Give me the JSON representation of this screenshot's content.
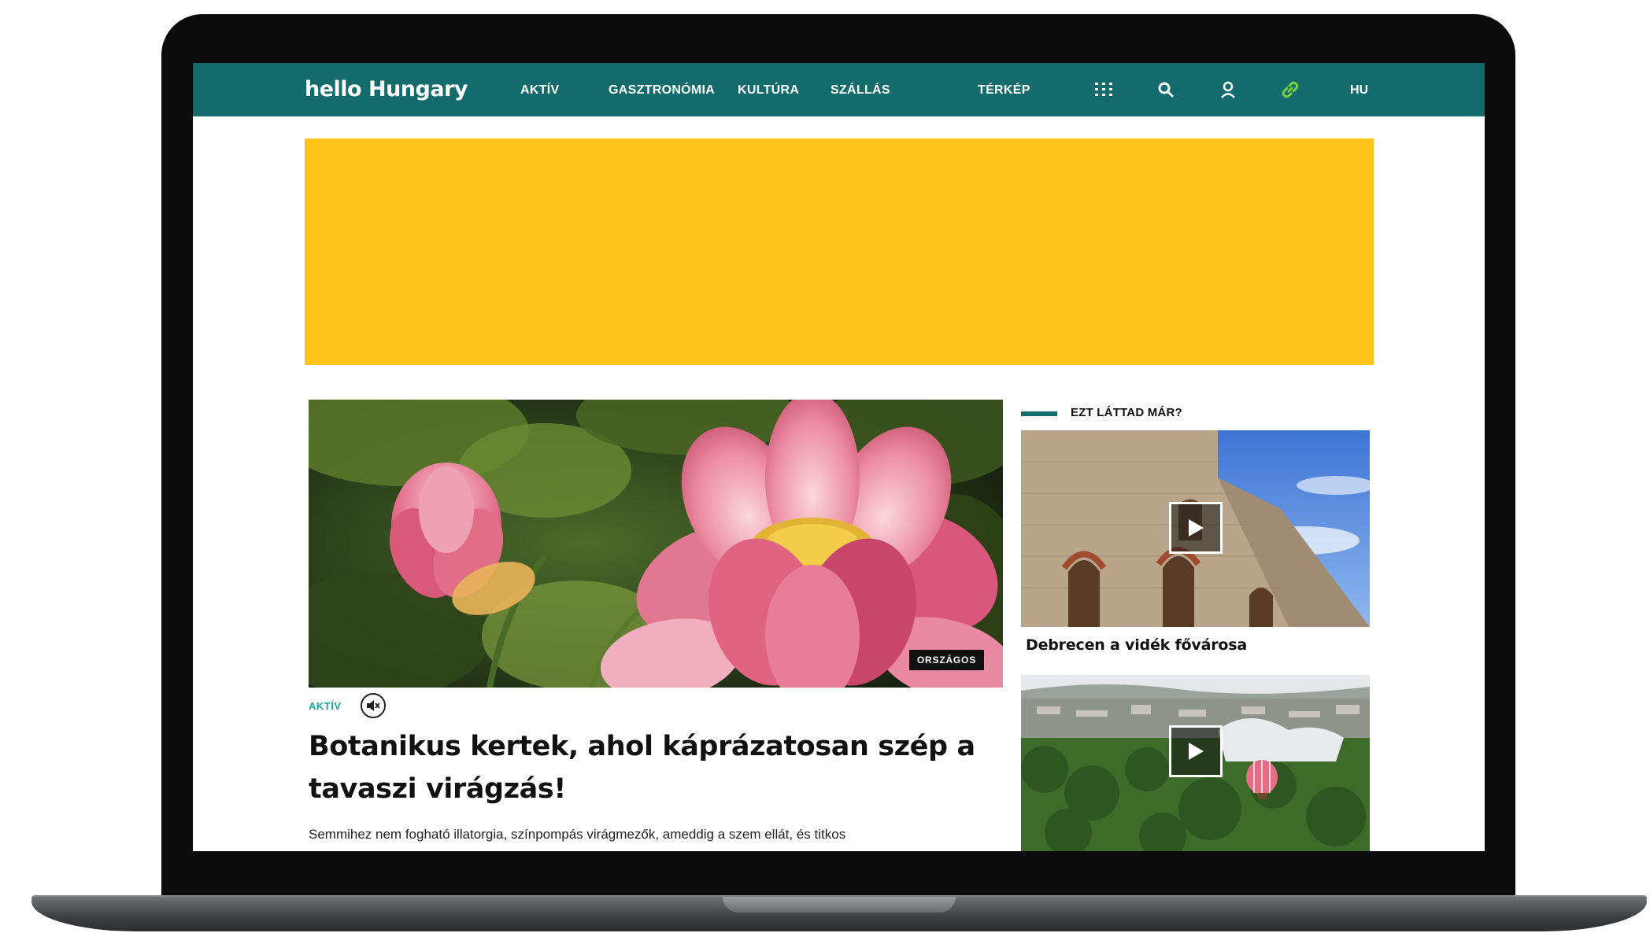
{
  "header": {
    "logo": "hello Hungary",
    "nav": [
      {
        "label": "AKTÍV"
      },
      {
        "label": "GASZTRONÓMIA"
      },
      {
        "label": "KULTÚRA"
      },
      {
        "label": "SZÁLLÁS"
      },
      {
        "label": "TÉRKÉP"
      }
    ],
    "icons": [
      "grid-menu-icon",
      "search-icon",
      "user-icon",
      "link-icon"
    ],
    "language": "HU",
    "colors": {
      "header_bg": "#136b6b",
      "accent_green": "#7ccf3a",
      "banner": "#fdc51c"
    }
  },
  "main_article": {
    "region_badge": "ORSZÁGOS",
    "category": "AKTÍV",
    "headline": "Botanikus kertek, ahol káprázatosan szép a tavaszi virágzás!",
    "lead": "Semmihez nem fogható illatorgia, színpompás virágmezők, ameddig a szem ellát, és titkos"
  },
  "sidebar": {
    "section_title": "EZT LÁTTAD MÁR?",
    "videos": [
      {
        "title": "Debrecen a vidék fővárosa"
      },
      {
        "title": ""
      }
    ]
  }
}
